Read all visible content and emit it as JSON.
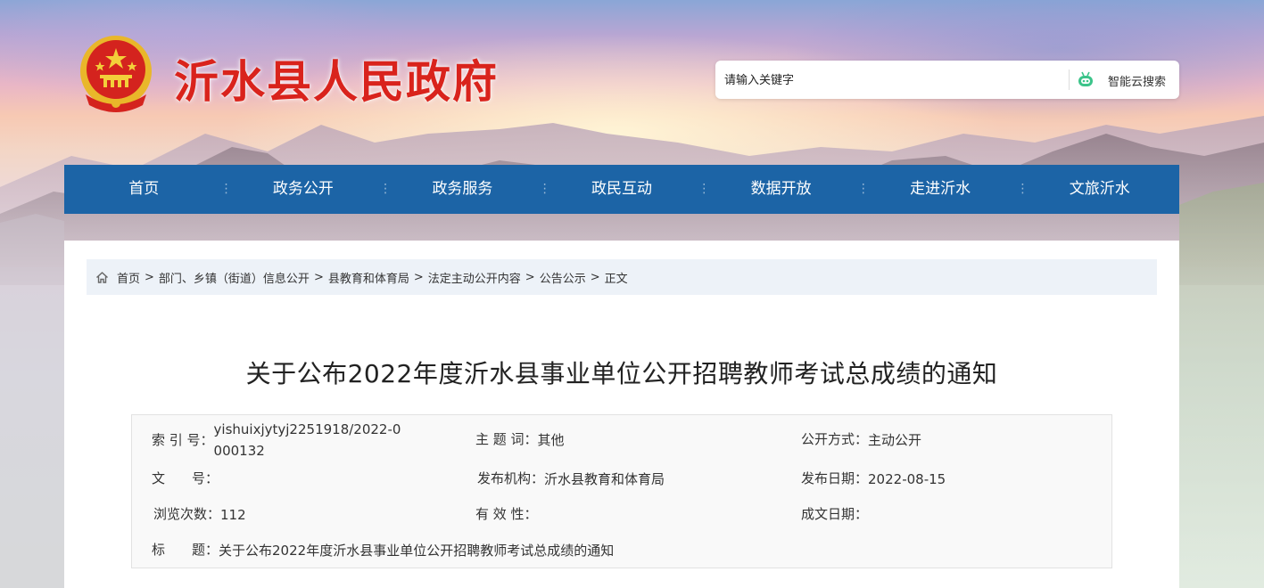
{
  "header": {
    "site_title": "沂水县人民政府",
    "search_placeholder": "请输入关键字",
    "search_button_label": "智能云搜索"
  },
  "nav": {
    "items": [
      "首页",
      "政务公开",
      "政务服务",
      "政民互动",
      "数据开放",
      "走进沂水",
      "文旅沂水"
    ]
  },
  "breadcrumb": {
    "items": [
      "首页",
      "部门、乡镇（街道）信息公开",
      "县教育和体育局",
      "法定主动公开内容",
      "公告公示"
    ],
    "separator": ">",
    "current": "正文"
  },
  "article": {
    "title": "关于公布2022年度沂水县事业单位公开招聘教师考试总成绩的通知"
  },
  "meta": {
    "index_label": "索 引 号：",
    "index_value": "yishuixjytyj2251918/2022-0000132",
    "topic_label": "主 题 词：",
    "topic_value": "其他",
    "disclosure_label": "公开方式：",
    "disclosure_value": "主动公开",
    "doc_no_label": "文　　号：",
    "doc_no_value": "",
    "publisher_label": "发布机构：",
    "publisher_value": "沂水县教育和体育局",
    "date_label": "发布日期：",
    "date_value": "2022-08-15",
    "views_label": "浏览次数：",
    "views_value": "112",
    "validity_label": "有 效 性：",
    "validity_value": "",
    "established_label": "成文日期：",
    "established_value": "",
    "subject_label": "标　　题：",
    "subject_value": "关于公布2022年度沂水县事业单位公开招聘教师考试总成绩的通知"
  },
  "colors": {
    "title_red": "#d9231c",
    "nav_blue": "#1c64a6",
    "breadcrumb_bg": "#edf2f8"
  }
}
